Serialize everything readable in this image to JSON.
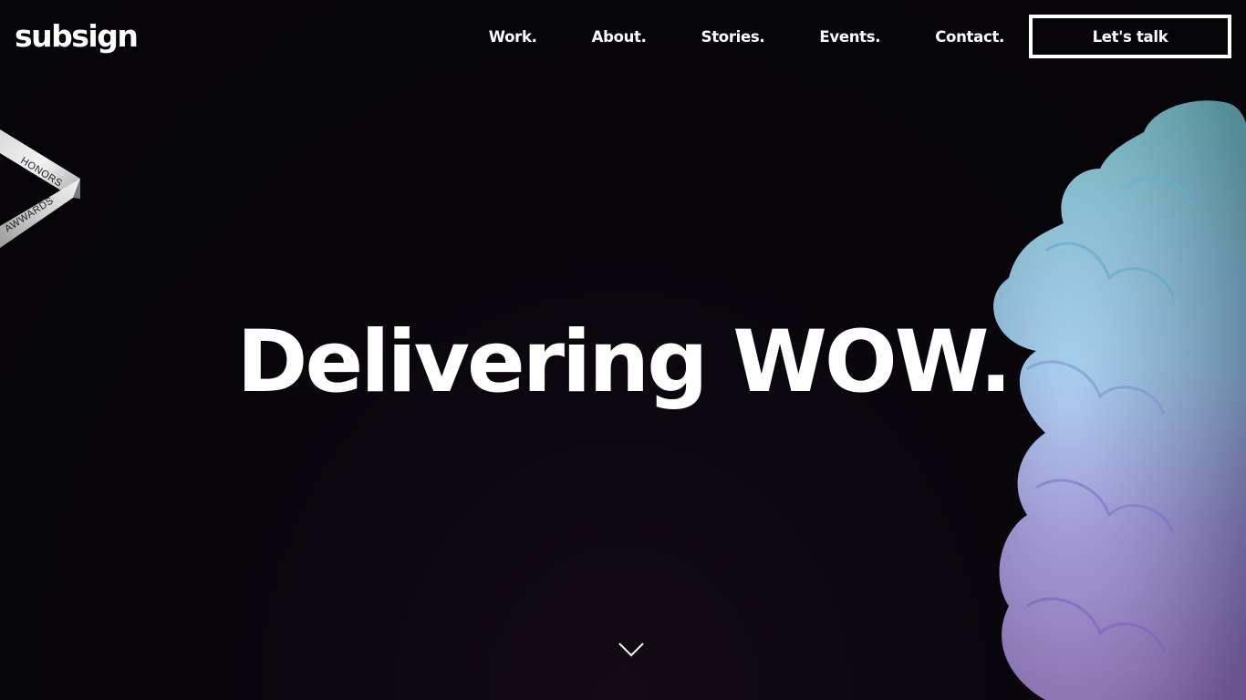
{
  "brand": {
    "logo_text": "subsign"
  },
  "nav": {
    "items": [
      {
        "label": "Work."
      },
      {
        "label": "About."
      },
      {
        "label": "Stories."
      },
      {
        "label": "Events."
      },
      {
        "label": "Contact."
      }
    ],
    "cta_label": "Let's talk"
  },
  "badge": {
    "line1": "HONORS",
    "line2": "AWWARDS"
  },
  "hero": {
    "headline": "Delivering WOW."
  },
  "icons": {
    "scroll": "chevron-down-icon"
  },
  "colors": {
    "background": "#07050a",
    "text": "#ffffff",
    "smoke_cyan": "#7fd6e6",
    "smoke_violet": "#9a86e0"
  }
}
